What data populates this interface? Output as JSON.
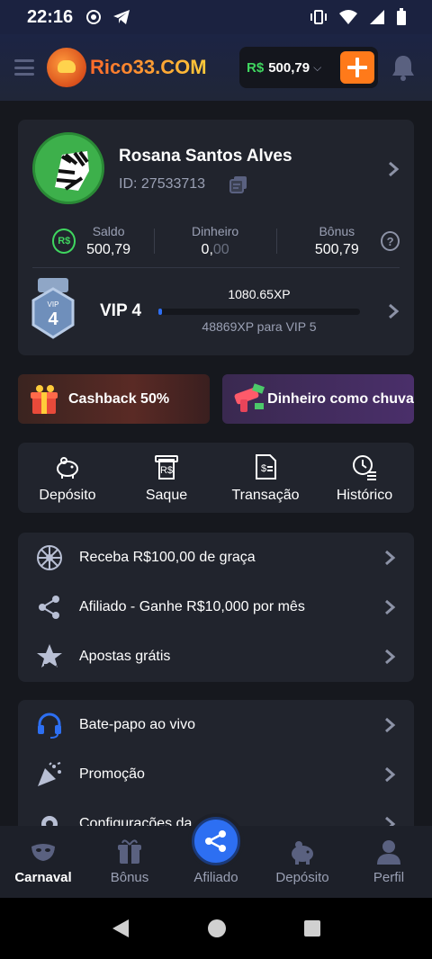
{
  "status_bar": {
    "time": "22:16"
  },
  "header": {
    "logo_text": "Rico33.COM",
    "balance_currency": "R$",
    "balance_amount": "500,79"
  },
  "profile": {
    "name": "Rosana Santos Alves",
    "id_text": "ID: 27533713",
    "stats": {
      "saldo_label": "Saldo",
      "saldo_value": "500,79",
      "dinheiro_label": "Dinheiro",
      "dinheiro_value_main": "0,",
      "dinheiro_value_dim": "00",
      "bonus_label": "Bônus",
      "bonus_value": "500,79",
      "currency_icon": "R$"
    },
    "vip": {
      "badge_level": "4",
      "badge_text": "VIP",
      "label": "VIP 4",
      "xp": "1080.65XP",
      "next": "48869XP para VIP 5",
      "progress": 0.02
    }
  },
  "promos": {
    "cashback": "Cashback 50%",
    "rain": "Dinheiro como chuva"
  },
  "actions": [
    {
      "label": "Depósito"
    },
    {
      "label": "Saque"
    },
    {
      "label": "Transação"
    },
    {
      "label": "Histórico"
    }
  ],
  "menu1": [
    {
      "label": "Receba R$100,00 de graça"
    },
    {
      "label": "Afiliado - Ganhe R$10,000 por mês"
    },
    {
      "label": "Apostas grátis"
    }
  ],
  "menu2": [
    {
      "label": "Bate-papo ao vivo"
    },
    {
      "label": "Promoção"
    },
    {
      "label": "Configurações da conta"
    }
  ],
  "bottom_nav": [
    {
      "label": "Carnaval"
    },
    {
      "label": "Bônus"
    },
    {
      "label": "Afiliado"
    },
    {
      "label": "Depósito"
    },
    {
      "label": "Perfil"
    }
  ],
  "colors": {
    "accent_orange": "#ff7a1a",
    "accent_green": "#3fd65f",
    "accent_blue": "#2d6ff2"
  }
}
